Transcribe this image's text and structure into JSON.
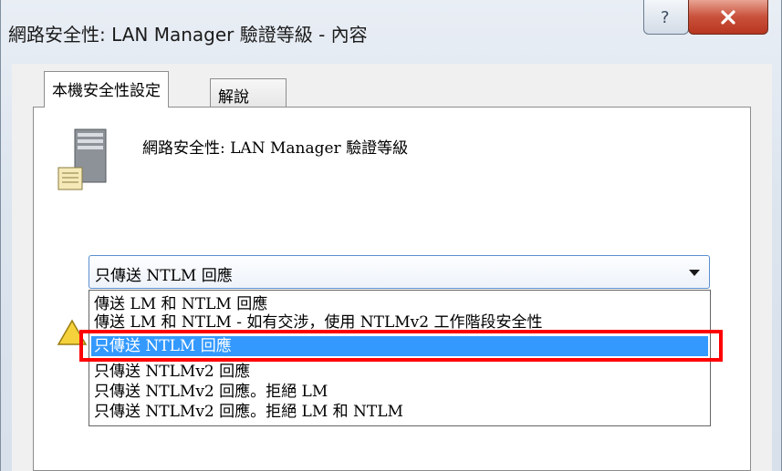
{
  "window": {
    "title": "網路安全性: LAN Manager 驗證等級 - 內容"
  },
  "tabs": [
    {
      "label": "本機安全性設定",
      "active": true
    },
    {
      "label": "解說",
      "active": false
    }
  ],
  "policy": {
    "name": "網路安全性: LAN Manager 驗證等級",
    "icon": "server-icon"
  },
  "combo": {
    "value": "只傳送 NTLM 回應"
  },
  "options": [
    "傳送 LM 和 NTLM 回應",
    "傳送 LM 和 NTLM - 如有交涉，使用 NTLMv2 工作階段安全性",
    "只傳送 NTLM 回應",
    "只傳送 NTLMv2 回應",
    "只傳送 NTLMv2 回應。拒絕 LM",
    "只傳送 NTLMv2 回應。拒絕 LM 和 NTLM"
  ],
  "selected_option_index": 2,
  "colors": {
    "selection": "#3399ff",
    "highlight_box": "#ff0000",
    "close_button": "#c9513b"
  }
}
